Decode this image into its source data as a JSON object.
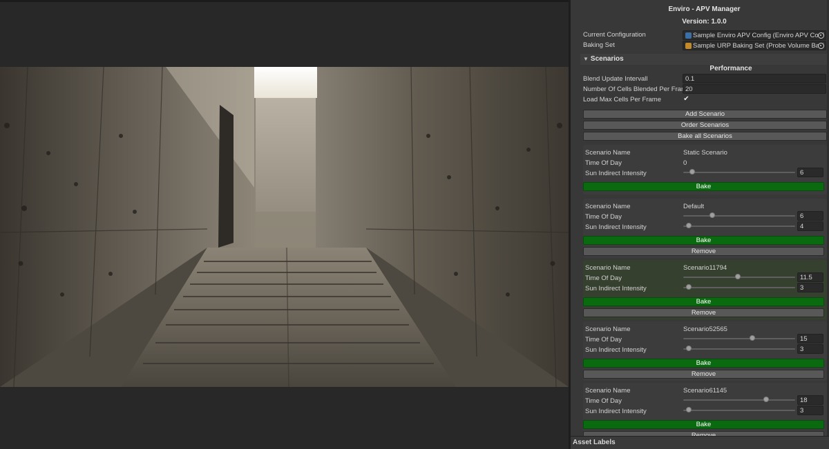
{
  "inspector": {
    "title": "Enviro - APV Manager",
    "version": "Version: 1.0.0",
    "current_configuration": {
      "label": "Current Configuration",
      "value": "Sample Enviro APV Config (Enviro APV Conf",
      "icon": "scriptable-object-icon"
    },
    "baking_set": {
      "label": "Baking Set",
      "value": "Sample URP Baking Set (Probe Volume Baki",
      "icon": "baking-set-icon"
    },
    "scenarios_foldout": "Scenarios",
    "performance_header": "Performance",
    "blend_update_interval": {
      "label": "Blend Update Intervall",
      "value": "0.1"
    },
    "cells_blended": {
      "label": "Number Of Cells Blended Per Fran",
      "value": "20"
    },
    "load_max_cells": {
      "label": "Load Max Cells Per Frame",
      "checked": "✔"
    },
    "buttons": {
      "add": "Add Scenario",
      "order": "Order Scenarios",
      "bake_all": "Bake all Scenarios"
    },
    "field_labels": {
      "name": "Scenario Name",
      "time": "Time Of Day",
      "sun": "Sun Indirect Intensity"
    },
    "bake_label": "Bake",
    "remove_label": "Remove",
    "scenarios": [
      {
        "name": "Static Scenario",
        "time_text": "0",
        "time_level": 0,
        "sun_value": "6",
        "sun_level": 0.08,
        "highlight": false,
        "has_remove": false
      },
      {
        "name": "Default",
        "time_value": "6",
        "time_level": 0.26,
        "sun_value": "4",
        "sun_level": 0.05,
        "highlight": false,
        "has_remove": true
      },
      {
        "name": "Scenario11794",
        "time_value": "11.5",
        "time_level": 0.49,
        "sun_value": "3",
        "sun_level": 0.05,
        "highlight": true,
        "has_remove": true
      },
      {
        "name": "Scenario52565",
        "time_value": "15",
        "time_level": 0.62,
        "sun_value": "3",
        "sun_level": 0.05,
        "highlight": false,
        "has_remove": true
      },
      {
        "name": "Scenario61145",
        "time_value": "18",
        "time_level": 0.74,
        "sun_value": "3",
        "sun_level": 0.05,
        "highlight": false,
        "has_remove": true
      }
    ]
  },
  "asset_labels": "Asset Labels",
  "colors": {
    "bake_button": "#0a6a0f",
    "panel": "#383838",
    "highlight_card": "#36402f"
  }
}
